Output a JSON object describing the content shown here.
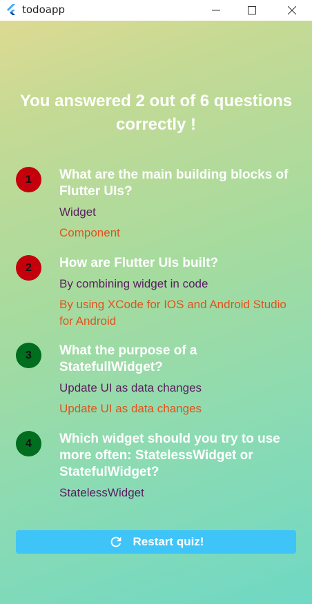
{
  "window": {
    "title": "todoapp",
    "icon": "flutter-logo-icon",
    "controls": [
      "minimize-icon",
      "maximize-icon",
      "close-icon"
    ]
  },
  "summary": {
    "text": "You answered 2 out of 6 questions correctly !"
  },
  "questions": [
    {
      "number": "1",
      "status": "incorrect",
      "question": "What are the main building blocks of Flutter UIs?",
      "user_answer": "Widget",
      "correct_answer": "Component"
    },
    {
      "number": "2",
      "status": "incorrect",
      "question": "How are Flutter UIs built?",
      "user_answer": "By combining widget in code",
      "correct_answer": "By using XCode for IOS and Android Studio for Android"
    },
    {
      "number": "3",
      "status": "correct",
      "question": "What the purpose of a StatefullWidget?",
      "user_answer": "Update UI as data changes",
      "correct_answer": "Update UI as data changes"
    },
    {
      "number": "4",
      "status": "correct",
      "question": "Which widget should you try to use more often: StatelessWidget or StatefulWidget?",
      "user_answer": "StatelessWidget",
      "correct_answer": ""
    }
  ],
  "restart_button": {
    "label": "Restart quiz!",
    "icon": "restart-icon"
  },
  "colors": {
    "incorrect_badge": "#c4000c",
    "correct_badge": "#006d1f",
    "user_answer": "#5a2060",
    "correct_answer": "#e0531c",
    "button": "#3fc4f8"
  }
}
